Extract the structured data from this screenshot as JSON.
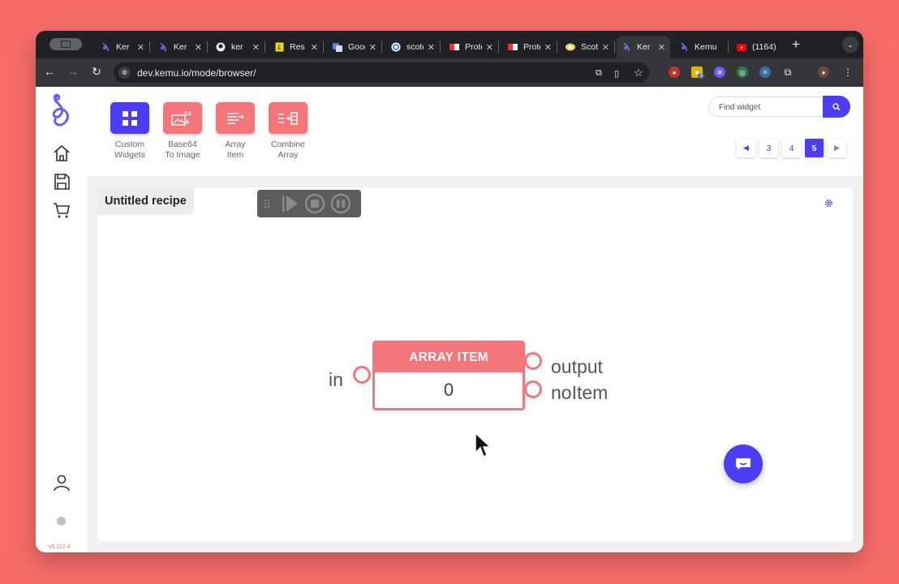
{
  "browser": {
    "tabs": [
      {
        "title": "Ker",
        "favicon": "kemu-icon",
        "active": false
      },
      {
        "title": "Ker",
        "favicon": "kemu-icon",
        "active": false
      },
      {
        "title": "ker",
        "favicon": "github-icon",
        "active": false
      },
      {
        "title": "Res",
        "favicon": "doc-icon",
        "active": false
      },
      {
        "title": "Google",
        "favicon": "google-translate-icon",
        "active": false
      },
      {
        "title": "scotch",
        "favicon": "google-icon",
        "active": false
      },
      {
        "title": "Protect",
        "favicon": "protect-icon",
        "active": false
      },
      {
        "title": "Protect",
        "favicon": "protect-icon",
        "active": false
      },
      {
        "title": "Scotch",
        "favicon": "scotch-icon",
        "active": false
      },
      {
        "title": "Ker",
        "favicon": "kemu-icon",
        "active": true
      },
      {
        "title": "Kemu",
        "favicon": "kemu-icon",
        "active": false
      },
      {
        "title": "(1164)",
        "favicon": "youtube-icon",
        "active": false
      }
    ],
    "new_tab_label": "+",
    "url": "dev.kemu.io/mode/browser/",
    "extension_badge": "3"
  },
  "sidebar": {
    "items": [
      {
        "name": "home-icon"
      },
      {
        "name": "save-icon"
      },
      {
        "name": "cart-icon"
      }
    ],
    "user_icon": "user-icon",
    "version": "v0.112.4"
  },
  "toolbar": {
    "widgets": [
      {
        "label_line1": "Custom",
        "label_line2": "Widgets",
        "color": "#4b3cf5",
        "icon": "grid-icon"
      },
      {
        "label_line1": "Base64",
        "label_line2": "To Image",
        "color": "#f4767a",
        "icon": "image-64-icon",
        "badge": "64"
      },
      {
        "label_line1": "Array",
        "label_line2": "Item",
        "color": "#f4767a",
        "icon": "array-item-icon"
      },
      {
        "label_line1": "Combine",
        "label_line2": "Array",
        "color": "#f4767a",
        "icon": "combine-array-icon"
      }
    ],
    "search_placeholder": "Find widget",
    "pages": [
      "3",
      "4",
      "5"
    ],
    "active_page": "5"
  },
  "recipe": {
    "title": "Untitled recipe",
    "node": {
      "title": "ARRAY ITEM",
      "value": "0",
      "input_port": "in",
      "output_ports": [
        "output",
        "noItem"
      ]
    }
  },
  "colors": {
    "background": "#f76d6a",
    "accent": "#4b3cf5",
    "node": "#f4767a"
  }
}
